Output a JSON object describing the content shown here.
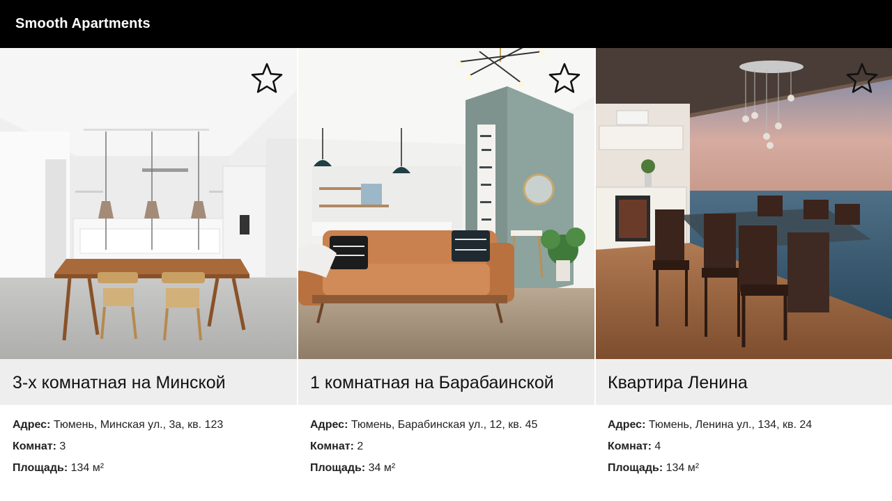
{
  "header": {
    "brand": "Smooth Apartments"
  },
  "colors": {
    "header_bg": "#000000",
    "title_band_bg": "#eeeeee",
    "text": "#111111"
  },
  "labels": {
    "address": "Адрес:",
    "rooms": "Комнат:",
    "area": "Площадь:"
  },
  "listings": [
    {
      "photo": "white kitchen with wooden dining table and pendant lamps",
      "favorite_icon": "star-outline-icon",
      "title": "3-х комнатная на Минской",
      "address": "Тюмень, Минская ул., 3а, кв. 123",
      "rooms": "3",
      "area": "134 м²"
    },
    {
      "photo": "living room with tan leather sofa and plants",
      "favorite_icon": "star-outline-icon",
      "title": "1 комнатная на Барабаинской",
      "address": "Тюмень, Барабинская ул., 12, кв. 45",
      "rooms": "2",
      "area": "34 м²"
    },
    {
      "photo": "dining room with glass table and sea view",
      "favorite_icon": "star-outline-icon",
      "title": "Квартира Ленина",
      "address": "Тюмень, Ленина ул., 134, кв. 24",
      "rooms": "4",
      "area": "134 м²"
    }
  ]
}
